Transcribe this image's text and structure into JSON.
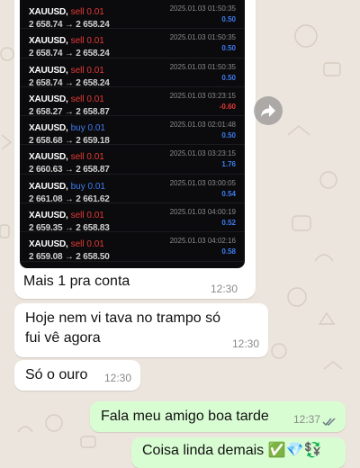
{
  "trade_rows": [
    {
      "symbol": "XAUUSD,",
      "side": "sell 0.01",
      "side_type": "sell",
      "prices": "2 658.74 → 2 658.24",
      "timestamp": "2025.01.03 01:50:35",
      "profit": "0.50",
      "profit_type": "pos"
    },
    {
      "symbol": "XAUUSD,",
      "side": "sell 0.01",
      "side_type": "sell",
      "prices": "2 658.74 → 2 658.24",
      "timestamp": "2025.01.03 01:50:35",
      "profit": "0.50",
      "profit_type": "pos"
    },
    {
      "symbol": "XAUUSD,",
      "side": "sell 0.01",
      "side_type": "sell",
      "prices": "2 658.74 → 2 658.24",
      "timestamp": "2025.01.03 01:50:35",
      "profit": "0.50",
      "profit_type": "pos"
    },
    {
      "symbol": "XAUUSD,",
      "side": "sell 0.01",
      "side_type": "sell",
      "prices": "2 658.27 → 2 658.87",
      "timestamp": "2025.01.03 03:23:15",
      "profit": "-0.60",
      "profit_type": "neg"
    },
    {
      "symbol": "XAUUSD,",
      "side": "buy 0.01",
      "side_type": "buy",
      "prices": "2 658.68 → 2 659.18",
      "timestamp": "2025.01.03 02:01:48",
      "profit": "0.50",
      "profit_type": "pos"
    },
    {
      "symbol": "XAUUSD,",
      "side": "sell 0.01",
      "side_type": "sell",
      "prices": "2 660.63 → 2 658.87",
      "timestamp": "2025.01.03 03:23:15",
      "profit": "1.76",
      "profit_type": "pos"
    },
    {
      "symbol": "XAUUSD,",
      "side": "buy 0.01",
      "side_type": "buy",
      "prices": "2 661.08 → 2 661.62",
      "timestamp": "2025.01.03 03:00:05",
      "profit": "0.54",
      "profit_type": "pos"
    },
    {
      "symbol": "XAUUSD,",
      "side": "sell 0.01",
      "side_type": "sell",
      "prices": "2 659.35 → 2 658.83",
      "timestamp": "2025.01.03 04:00:19",
      "profit": "0.52",
      "profit_type": "pos"
    },
    {
      "symbol": "XAUUSD,",
      "side": "sell 0.01",
      "side_type": "sell",
      "prices": "2 659.08 → 2 658.50",
      "timestamp": "2025.01.03 04:02:16",
      "profit": "0.58",
      "profit_type": "pos"
    }
  ],
  "media_message": {
    "caption": "Mais 1 pra conta",
    "time": "12:30"
  },
  "messages": [
    {
      "text": "Hoje nem vi tava no trampo só fui vê agora",
      "time": "12:30",
      "direction": "incoming"
    },
    {
      "text": "Só o ouro",
      "time": "12:30",
      "direction": "incoming"
    },
    {
      "text": "Fala meu amigo boa tarde",
      "time": "12:37",
      "direction": "outgoing",
      "status": "read"
    },
    {
      "text": "Coisa linda demais ✅💎💱",
      "direction": "outgoing"
    }
  ],
  "icons": {
    "forward": "forward-icon",
    "read_receipt": "double-check-icon"
  },
  "colors": {
    "incoming_bubble": "#ffffff",
    "outgoing_bubble": "#d9fdd3",
    "chat_background": "#ece5dd",
    "sell": "#e53935",
    "buy": "#3d7cf0"
  }
}
